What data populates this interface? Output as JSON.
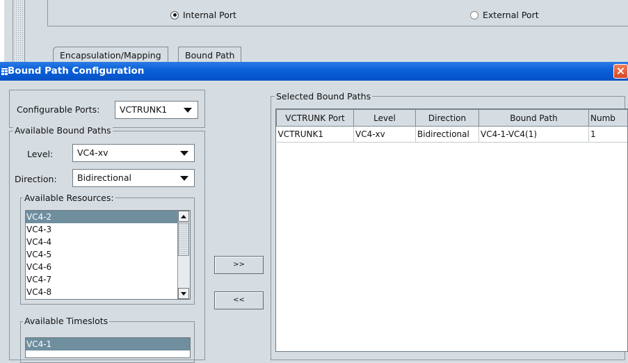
{
  "background_window": {
    "port_options": [
      {
        "label": "Internal Port",
        "selected": true
      },
      {
        "label": "External Port",
        "selected": false
      }
    ],
    "tabs": [
      {
        "label": "Encapsulation/Mapping",
        "active": false
      },
      {
        "label": "Bound Path",
        "active": true
      }
    ]
  },
  "dialog": {
    "title": "Bound Path Configuration",
    "close_glyph": "×",
    "configurable_ports": {
      "label": "Configurable Ports:",
      "value": "VCTRUNK1"
    },
    "available_bound_paths": {
      "title": "Available Bound Paths",
      "level": {
        "label": "Level:",
        "value": "VC4-xv"
      },
      "direction": {
        "label": "Direction:",
        "value": "Bidirectional"
      },
      "available_resources": {
        "title": "Available Resources:",
        "items": [
          "VC4-2",
          "VC4-3",
          "VC4-4",
          "VC4-5",
          "VC4-6",
          "VC4-7",
          "VC4-8"
        ],
        "selected_index": 0
      },
      "available_timeslots": {
        "title": "Available Timeslots",
        "items": [
          "VC4-1"
        ],
        "selected_index": 0
      }
    },
    "buttons": {
      "add": ">>",
      "remove": "<<"
    },
    "selected_bound_paths": {
      "title": "Selected Bound Paths",
      "columns": [
        "VCTRUNK Port",
        "Level",
        "Direction",
        "Bound Path",
        "Numb"
      ],
      "rows": [
        [
          "VCTRUNK1",
          "VC4-xv",
          "Bidirectional",
          "VC4-1-VC4(1)",
          "1"
        ]
      ]
    }
  },
  "colors": {
    "title_bar": "#0a5fd8",
    "selection": "#6f8e9e",
    "window_bg": "#d6dde2",
    "close_button": "#d64725"
  }
}
